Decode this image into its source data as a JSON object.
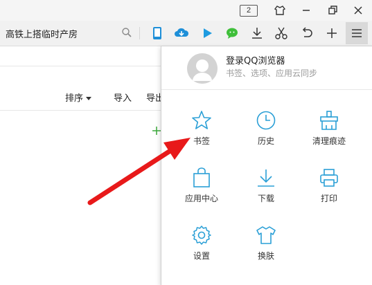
{
  "titlebar": {
    "tab_count": "2",
    "icons": [
      "skin-icon",
      "minimize-icon",
      "restore-icon",
      "close-icon"
    ]
  },
  "toolbar": {
    "search_value": "高铁上搭临时产房",
    "tools": [
      "phone-icon",
      "cloud-download-icon",
      "video-play-icon",
      "wechat-icon",
      "download-icon",
      "scissors-icon",
      "undo-icon",
      "new-tab-plus-icon",
      "menu-icon"
    ]
  },
  "page": {
    "sort_label": "排序",
    "import_label": "导入",
    "export_label": "导出"
  },
  "menu": {
    "login_title": "登录QQ浏览器",
    "login_sub": "书签、选项、应用云同步",
    "items": [
      {
        "label": "书签",
        "icon": "star-icon"
      },
      {
        "label": "历史",
        "icon": "clock-icon"
      },
      {
        "label": "清理痕迹",
        "icon": "broom-icon"
      },
      {
        "label": "应用中心",
        "icon": "bag-icon"
      },
      {
        "label": "下载",
        "icon": "download-icon"
      },
      {
        "label": "打印",
        "icon": "printer-icon"
      },
      {
        "label": "设置",
        "icon": "gear-icon"
      },
      {
        "label": "换肤",
        "icon": "tshirt-icon"
      }
    ]
  },
  "colors": {
    "accent": "#2a9fd6",
    "arrow": "#e8191a",
    "toolbar_bg": "#f1f1f1"
  }
}
